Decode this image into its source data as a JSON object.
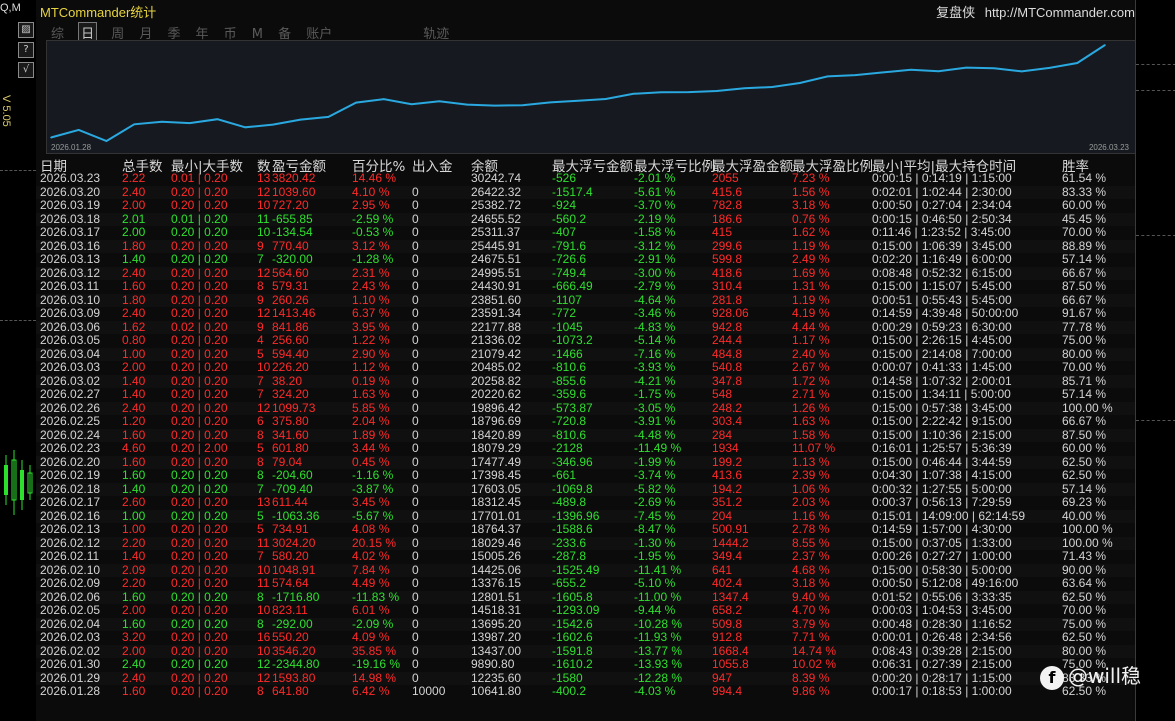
{
  "left_strip": {
    "top_text": "Q,M",
    "version": "V 5.05",
    "buttons": [
      "▨",
      "?",
      "√"
    ]
  },
  "title": "MTCommander统计",
  "header_right": {
    "label": "复盘侠",
    "url": "http://MTCommander.com"
  },
  "tabs": [
    {
      "label": "综",
      "active": false
    },
    {
      "label": "日",
      "active": true
    },
    {
      "label": "周",
      "active": false
    },
    {
      "label": "月",
      "active": false
    },
    {
      "label": "季",
      "active": false
    },
    {
      "label": "年",
      "active": false
    },
    {
      "label": "币",
      "active": false
    },
    {
      "label": "M",
      "active": false
    },
    {
      "label": "备",
      "active": false
    },
    {
      "label": "账户",
      "active": false
    },
    {
      "label": "轨迹",
      "active": false
    }
  ],
  "chart_data": {
    "type": "line",
    "x_start_label": "2026.01.28",
    "x_end_label": "2026.03.23",
    "x": [
      "2026.01.28",
      "2026.01.29",
      "2026.01.30",
      "2026.02.02",
      "2026.02.03",
      "2026.02.04",
      "2026.02.05",
      "2026.02.06",
      "2026.02.09",
      "2026.02.10",
      "2026.02.11",
      "2026.02.12",
      "2026.02.13",
      "2026.02.16",
      "2026.02.17",
      "2026.02.18",
      "2026.02.19",
      "2026.02.20",
      "2026.02.23",
      "2026.02.24",
      "2026.02.25",
      "2026.02.26",
      "2026.02.27",
      "2026.03.02",
      "2026.03.03",
      "2026.03.04",
      "2026.03.05",
      "2026.03.06",
      "2026.03.09",
      "2026.03.10",
      "2026.03.11",
      "2026.03.12",
      "2026.03.13",
      "2026.03.16",
      "2026.03.17",
      "2026.03.18",
      "2026.03.19",
      "2026.03.20",
      "2026.03.23"
    ],
    "values": [
      10641.8,
      12235.6,
      9890.8,
      13437.0,
      13987.2,
      13695.2,
      14518.31,
      12801.51,
      13376.15,
      14425.06,
      15005.26,
      18029.46,
      18764.37,
      17701.01,
      18312.45,
      17603.05,
      17398.45,
      17477.49,
      18079.29,
      18420.89,
      18796.69,
      19896.42,
      20220.62,
      20258.82,
      20485.02,
      21079.42,
      21336.02,
      22177.88,
      23591.34,
      23851.6,
      24430.91,
      24995.51,
      24675.51,
      25445.91,
      25311.37,
      24655.52,
      25382.72,
      26422.32,
      30242.74
    ],
    "line_color": "#2aa8e0",
    "background": "#161a20"
  },
  "table": {
    "headers": [
      "日期",
      "总手数",
      "最小|大手数",
      "数",
      "盈亏金额",
      "百分比%",
      "出入金",
      "余额",
      "最大浮亏金额",
      "最大浮亏比例",
      "最大浮盈金额",
      "最大浮盈比例",
      "最小|平均|最大持仓时间",
      "胜率"
    ],
    "rows": [
      [
        "2026.03.23",
        "2.22",
        "0.01 | 0.20",
        "13",
        "3820.42",
        "14.46 %",
        "",
        "30242.74",
        "-526",
        "-2.01 %",
        "2055",
        "7.23 %",
        "0:00:15 | 0:14:19 | 1:15:00",
        "61.54 %"
      ],
      [
        "2026.03.20",
        "2.40",
        "0.20 | 0.20",
        "12",
        "1039.60",
        "4.10 %",
        "0",
        "26422.32",
        "-1517.4",
        "-5.61 %",
        "415.6",
        "1.56 %",
        "0:02:01 | 1:02:44 | 2:30:00",
        "83.33 %"
      ],
      [
        "2026.03.19",
        "2.00",
        "0.20 | 0.20",
        "10",
        "727.20",
        "2.95 %",
        "0",
        "25382.72",
        "-924",
        "-3.70 %",
        "782.8",
        "3.18 %",
        "0:00:50 | 0:27:04 | 2:34:04",
        "60.00 %"
      ],
      [
        "2026.03.18",
        "2.01",
        "0.01 | 0.20",
        "11",
        "-655.85",
        "-2.59 %",
        "0",
        "24655.52",
        "-560.2",
        "-2.19 %",
        "186.6",
        "0.76 %",
        "0:00:15 | 0:46:50 | 2:50:34",
        "45.45 %"
      ],
      [
        "2026.03.17",
        "2.00",
        "0.20 | 0.20",
        "10",
        "-134.54",
        "-0.53 %",
        "0",
        "25311.37",
        "-407",
        "-1.58 %",
        "415",
        "1.62 %",
        "0:11:46 | 1:23:52 | 3:45:00",
        "70.00 %"
      ],
      [
        "2026.03.16",
        "1.80",
        "0.20 | 0.20",
        "9",
        "770.40",
        "3.12 %",
        "0",
        "25445.91",
        "-791.6",
        "-3.12 %",
        "299.6",
        "1.19 %",
        "0:15:00 | 1:06:39 | 3:45:00",
        "88.89 %"
      ],
      [
        "2026.03.13",
        "1.40",
        "0.20 | 0.20",
        "7",
        "-320.00",
        "-1.28 %",
        "0",
        "24675.51",
        "-726.6",
        "-2.91 %",
        "599.8",
        "2.49 %",
        "0:02:20 | 1:16:49 | 6:00:00",
        "57.14 %"
      ],
      [
        "2026.03.12",
        "2.40",
        "0.20 | 0.20",
        "12",
        "564.60",
        "2.31 %",
        "0",
        "24995.51",
        "-749.4",
        "-3.00 %",
        "418.6",
        "1.69 %",
        "0:08:48 | 0:52:32 | 6:15:00",
        "66.67 %"
      ],
      [
        "2026.03.11",
        "1.60",
        "0.20 | 0.20",
        "8",
        "579.31",
        "2.43 %",
        "0",
        "24430.91",
        "-666.49",
        "-2.79 %",
        "310.4",
        "1.31 %",
        "0:15:00 | 1:15:07 | 5:45:00",
        "87.50 %"
      ],
      [
        "2026.03.10",
        "1.80",
        "0.20 | 0.20",
        "9",
        "260.26",
        "1.10 %",
        "0",
        "23851.60",
        "-1107",
        "-4.64 %",
        "281.8",
        "1.19 %",
        "0:00:51 | 0:55:43 | 5:45:00",
        "66.67 %"
      ],
      [
        "2026.03.09",
        "2.40",
        "0.20 | 0.20",
        "12",
        "1413.46",
        "6.37 %",
        "0",
        "23591.34",
        "-772",
        "-3.46 %",
        "928.06",
        "4.19 %",
        "0:14:59 | 4:39:48 | 50:00:00",
        "91.67 %"
      ],
      [
        "2026.03.06",
        "1.62",
        "0.02 | 0.20",
        "9",
        "841.86",
        "3.95 %",
        "0",
        "22177.88",
        "-1045",
        "-4.83 %",
        "942.8",
        "4.44 %",
        "0:00:29 | 0:59:23 | 6:30:00",
        "77.78 %"
      ],
      [
        "2026.03.05",
        "0.80",
        "0.20 | 0.20",
        "4",
        "256.60",
        "1.22 %",
        "0",
        "21336.02",
        "-1073.2",
        "-5.14 %",
        "244.4",
        "1.17 %",
        "0:15:00 | 2:26:15 | 4:45:00",
        "75.00 %"
      ],
      [
        "2026.03.04",
        "1.00",
        "0.20 | 0.20",
        "5",
        "594.40",
        "2.90 %",
        "0",
        "21079.42",
        "-1466",
        "-7.16 %",
        "484.8",
        "2.40 %",
        "0:15:00 | 2:14:08 | 7:00:00",
        "80.00 %"
      ],
      [
        "2026.03.03",
        "2.00",
        "0.20 | 0.20",
        "10",
        "226.20",
        "1.12 %",
        "0",
        "20485.02",
        "-810.6",
        "-3.93 %",
        "540.8",
        "2.67 %",
        "0:00:07 | 0:41:33 | 1:45:00",
        "70.00 %"
      ],
      [
        "2026.03.02",
        "1.40",
        "0.20 | 0.20",
        "7",
        "38.20",
        "0.19 %",
        "0",
        "20258.82",
        "-855.6",
        "-4.21 %",
        "347.8",
        "1.72 %",
        "0:14:58 | 1:07:32 | 2:00:01",
        "85.71 %"
      ],
      [
        "2026.02.27",
        "1.40",
        "0.20 | 0.20",
        "7",
        "324.20",
        "1.63 %",
        "0",
        "20220.62",
        "-359.6",
        "-1.75 %",
        "548",
        "2.71 %",
        "0:15:00 | 1:34:11 | 5:00:00",
        "57.14 %"
      ],
      [
        "2026.02.26",
        "2.40",
        "0.20 | 0.20",
        "12",
        "1099.73",
        "5.85 %",
        "0",
        "19896.42",
        "-573.87",
        "-3.05 %",
        "248.2",
        "1.26 %",
        "0:15:00 | 0:57:38 | 3:45:00",
        "100.00 %"
      ],
      [
        "2026.02.25",
        "1.20",
        "0.20 | 0.20",
        "6",
        "375.80",
        "2.04 %",
        "0",
        "18796.69",
        "-720.8",
        "-3.91 %",
        "303.4",
        "1.63 %",
        "0:15:00 | 2:22:42 | 9:15:00",
        "66.67 %"
      ],
      [
        "2026.02.24",
        "1.60",
        "0.20 | 0.20",
        "8",
        "341.60",
        "1.89 %",
        "0",
        "18420.89",
        "-810.6",
        "-4.48 %",
        "284",
        "1.58 %",
        "0:15:00 | 1:10:36 | 2:15:00",
        "87.50 %"
      ],
      [
        "2026.02.23",
        "4.60",
        "0.20 | 2.00",
        "5",
        "601.80",
        "3.44 %",
        "0",
        "18079.29",
        "-2128",
        "-11.49 %",
        "1934",
        "11.07 %",
        "0:16:01 | 1:25:57 | 5:36:39",
        "60.00 %"
      ],
      [
        "2026.02.20",
        "1.60",
        "0.20 | 0.20",
        "8",
        "79.04",
        "0.45 %",
        "0",
        "17477.49",
        "-346.96",
        "-1.99 %",
        "199.2",
        "1.13 %",
        "0:15:00 | 0:46:44 | 3:44:59",
        "62.50 %"
      ],
      [
        "2026.02.19",
        "1.60",
        "0.20 | 0.20",
        "8",
        "-204.60",
        "-1.16 %",
        "0",
        "17398.45",
        "-661",
        "-3.74 %",
        "413.6",
        "2.39 %",
        "0:04:30 | 1:07:38 | 4:15:00",
        "62.50 %"
      ],
      [
        "2026.02.18",
        "1.40",
        "0.20 | 0.20",
        "7",
        "-709.40",
        "-3.87 %",
        "0",
        "17603.05",
        "-1069.8",
        "-5.82 %",
        "194.2",
        "1.06 %",
        "0:00:32 | 1:27:55 | 5:00:00",
        "57.14 %"
      ],
      [
        "2026.02.17",
        "2.60",
        "0.20 | 0.20",
        "13",
        "611.44",
        "3.45 %",
        "0",
        "18312.45",
        "-489.8",
        "-2.69 %",
        "351.2",
        "2.03 %",
        "0:00:37 | 0:56:13 | 7:29:59",
        "69.23 %"
      ],
      [
        "2026.02.16",
        "1.00",
        "0.20 | 0.20",
        "5",
        "-1063.36",
        "-5.67 %",
        "0",
        "17701.01",
        "-1396.96",
        "-7.45 %",
        "204",
        "1.16 %",
        "0:15:01 | 14:09:00 | 62:14:59",
        "40.00 %"
      ],
      [
        "2026.02.13",
        "1.00",
        "0.20 | 0.20",
        "5",
        "734.91",
        "4.08 %",
        "0",
        "18764.37",
        "-1588.6",
        "-8.47 %",
        "500.91",
        "2.78 %",
        "0:14:59 | 1:57:00 | 4:30:00",
        "100.00 %"
      ],
      [
        "2026.02.12",
        "2.20",
        "0.20 | 0.20",
        "11",
        "3024.20",
        "20.15 %",
        "0",
        "18029.46",
        "-233.6",
        "-1.30 %",
        "1444.2",
        "8.55 %",
        "0:15:00 | 0:37:05 | 1:33:00",
        "100.00 %"
      ],
      [
        "2026.02.11",
        "1.40",
        "0.20 | 0.20",
        "7",
        "580.20",
        "4.02 %",
        "0",
        "15005.26",
        "-287.8",
        "-1.95 %",
        "349.4",
        "2.37 %",
        "0:00:26 | 0:27:27 | 1:00:00",
        "71.43 %"
      ],
      [
        "2026.02.10",
        "2.09",
        "0.20 | 0.20",
        "10",
        "1048.91",
        "7.84 %",
        "0",
        "14425.06",
        "-1525.49",
        "-11.41 %",
        "641",
        "4.68 %",
        "0:15:00 | 0:58:30 | 5:00:00",
        "90.00 %"
      ],
      [
        "2026.02.09",
        "2.20",
        "0.20 | 0.20",
        "11",
        "574.64",
        "4.49 %",
        "0",
        "13376.15",
        "-655.2",
        "-5.10 %",
        "402.4",
        "3.18 %",
        "0:00:50 | 5:12:08 | 49:16:00",
        "63.64 %"
      ],
      [
        "2026.02.06",
        "1.60",
        "0.20 | 0.20",
        "8",
        "-1716.80",
        "-11.83 %",
        "0",
        "12801.51",
        "-1605.8",
        "-11.00 %",
        "1347.4",
        "9.40 %",
        "0:01:52 | 0:55:06 | 3:33:35",
        "62.50 %"
      ],
      [
        "2026.02.05",
        "2.00",
        "0.20 | 0.20",
        "10",
        "823.11",
        "6.01 %",
        "0",
        "14518.31",
        "-1293.09",
        "-9.44 %",
        "658.2",
        "4.70 %",
        "0:00:03 | 1:04:53 | 3:45:00",
        "70.00 %"
      ],
      [
        "2026.02.04",
        "1.60",
        "0.20 | 0.20",
        "8",
        "-292.00",
        "-2.09 %",
        "0",
        "13695.20",
        "-1542.6",
        "-10.28 %",
        "509.8",
        "3.79 %",
        "0:00:48 | 0:28:30 | 1:16:52",
        "75.00 %"
      ],
      [
        "2026.02.03",
        "3.20",
        "0.20 | 0.20",
        "16",
        "550.20",
        "4.09 %",
        "0",
        "13987.20",
        "-1602.6",
        "-11.93 %",
        "912.8",
        "7.71 %",
        "0:00:01 | 0:26:48 | 2:34:56",
        "62.50 %"
      ],
      [
        "2026.02.02",
        "2.00",
        "0.20 | 0.20",
        "10",
        "3546.20",
        "35.85 %",
        "0",
        "13437.00",
        "-1591.8",
        "-13.77 %",
        "1668.4",
        "14.74 %",
        "0:08:43 | 0:39:28 | 2:15:00",
        "80.00 %"
      ],
      [
        "2026.01.30",
        "2.40",
        "0.20 | 0.20",
        "12",
        "-2344.80",
        "-19.16 %",
        "0",
        "9890.80",
        "-1610.2",
        "-13.93 %",
        "1055.8",
        "10.02 %",
        "0:06:31 | 0:27:39 | 2:15:00",
        "75.00 %"
      ],
      [
        "2026.01.29",
        "2.40",
        "0.20 | 0.20",
        "12",
        "1593.80",
        "14.98 %",
        "0",
        "12235.60",
        "-1580",
        "-12.28 %",
        "947",
        "8.39 %",
        "0:00:20 | 0:28:17 | 1:15:00",
        "83.33 %"
      ],
      [
        "2026.01.28",
        "1.60",
        "0.20 | 0.20",
        "8",
        "641.80",
        "6.42 %",
        "10000",
        "10641.80",
        "-400.2",
        "-4.03 %",
        "994.4",
        "9.86 %",
        "0:00:17 | 0:18:53 | 1:00:00",
        "62.50 %"
      ]
    ]
  },
  "colors": {
    "profit": "#ff2a2a",
    "loss": "#2ee02e",
    "neutral": "#d4d4d4",
    "title": "#e8d440",
    "chart_line": "#2aa8e0"
  },
  "watermark": "@will稳"
}
